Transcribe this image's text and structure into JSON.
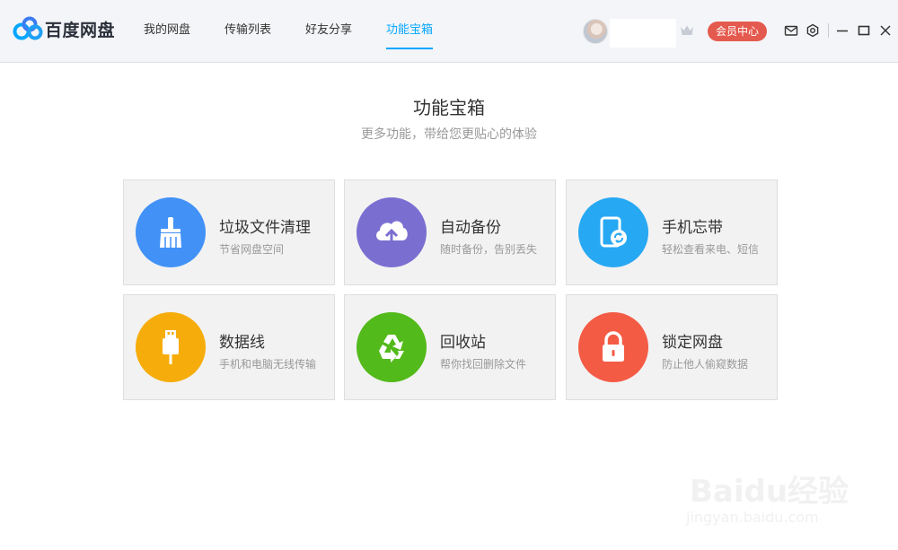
{
  "app": {
    "logo_text": "百度网盘",
    "accent_color": "#06a7ff"
  },
  "nav": {
    "tabs": [
      {
        "label": "我的网盘",
        "active": false
      },
      {
        "label": "传输列表",
        "active": false
      },
      {
        "label": "好友分享",
        "active": false
      },
      {
        "label": "功能宝箱",
        "active": true
      }
    ]
  },
  "user": {
    "vip_label": "会员中心",
    "vip_color": "#e45a4e"
  },
  "icons": {
    "mail": "mail-icon",
    "settings": "gear-icon",
    "minimize": "minimize-icon",
    "maximize": "maximize-icon",
    "close": "close-icon"
  },
  "main": {
    "title": "功能宝箱",
    "subtitle": "更多功能，带给您更贴心的体验"
  },
  "tools": [
    {
      "title": "垃圾文件清理",
      "desc": "节省网盘空间",
      "icon": "broom-icon",
      "color": "#4191f7"
    },
    {
      "title": "自动备份",
      "desc": "随时备份，告别丢失",
      "icon": "cloud-upload-icon",
      "color": "#7a6fd1"
    },
    {
      "title": "手机忘带",
      "desc": "轻松查看来电、短信",
      "icon": "phone-sync-icon",
      "color": "#27a8f3"
    },
    {
      "title": "数据线",
      "desc": "手机和电脑无线传输",
      "icon": "usb-cable-icon",
      "color": "#f6ad0b"
    },
    {
      "title": "回收站",
      "desc": "帮你找回删除文件",
      "icon": "recycle-icon",
      "color": "#52ba1a"
    },
    {
      "title": "锁定网盘",
      "desc": "防止他人偷窥数据",
      "icon": "lock-icon",
      "color": "#f45b45"
    }
  ],
  "watermark": {
    "text": "Baidu经验",
    "url": "jingyan.baidu.com"
  }
}
